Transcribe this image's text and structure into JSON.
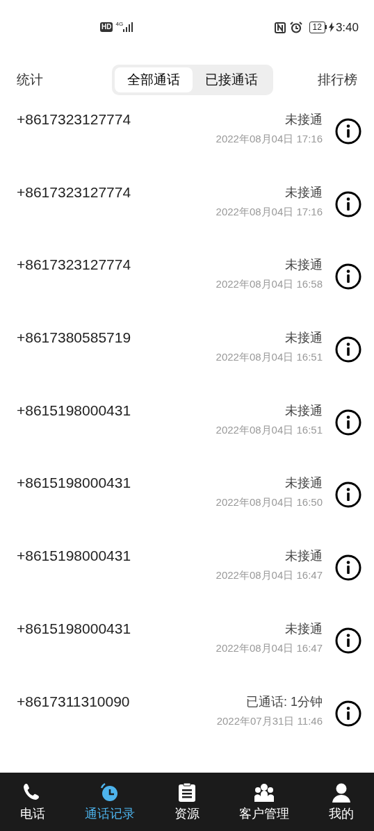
{
  "status_bar": {
    "hd": "HD",
    "network": "4G",
    "battery": "12",
    "time": "3:40"
  },
  "header": {
    "left": "统计",
    "right": "排行榜",
    "segments": [
      {
        "label": "全部通话",
        "selected": true
      },
      {
        "label": "已接通话",
        "selected": false
      }
    ]
  },
  "calls": [
    {
      "number": "+8617323127774",
      "status": "未接通",
      "time": "2022年08月04日 17:16"
    },
    {
      "number": "+8617323127774",
      "status": "未接通",
      "time": "2022年08月04日 17:16"
    },
    {
      "number": "+8617323127774",
      "status": "未接通",
      "time": "2022年08月04日 16:58"
    },
    {
      "number": "+8617380585719",
      "status": "未接通",
      "time": "2022年08月04日 16:51"
    },
    {
      "number": "+8615198000431",
      "status": "未接通",
      "time": "2022年08月04日 16:51"
    },
    {
      "number": "+8615198000431",
      "status": "未接通",
      "time": "2022年08月04日 16:50"
    },
    {
      "number": "+8615198000431",
      "status": "未接通",
      "time": "2022年08月04日 16:47"
    },
    {
      "number": "+8615198000431",
      "status": "未接通",
      "time": "2022年08月04日 16:47"
    },
    {
      "number": "+8617311310090",
      "status": "已通话: 1分钟",
      "time": "2022年07月31日 11:46"
    }
  ],
  "tab_bar": [
    {
      "kind": "phone",
      "label": "电话",
      "selected": false
    },
    {
      "kind": "history",
      "label": "通话记录",
      "selected": true
    },
    {
      "kind": "resource",
      "label": "资源",
      "selected": false
    },
    {
      "kind": "customers",
      "label": "客户管理",
      "selected": false
    },
    {
      "kind": "me",
      "label": "我的",
      "selected": false
    }
  ]
}
